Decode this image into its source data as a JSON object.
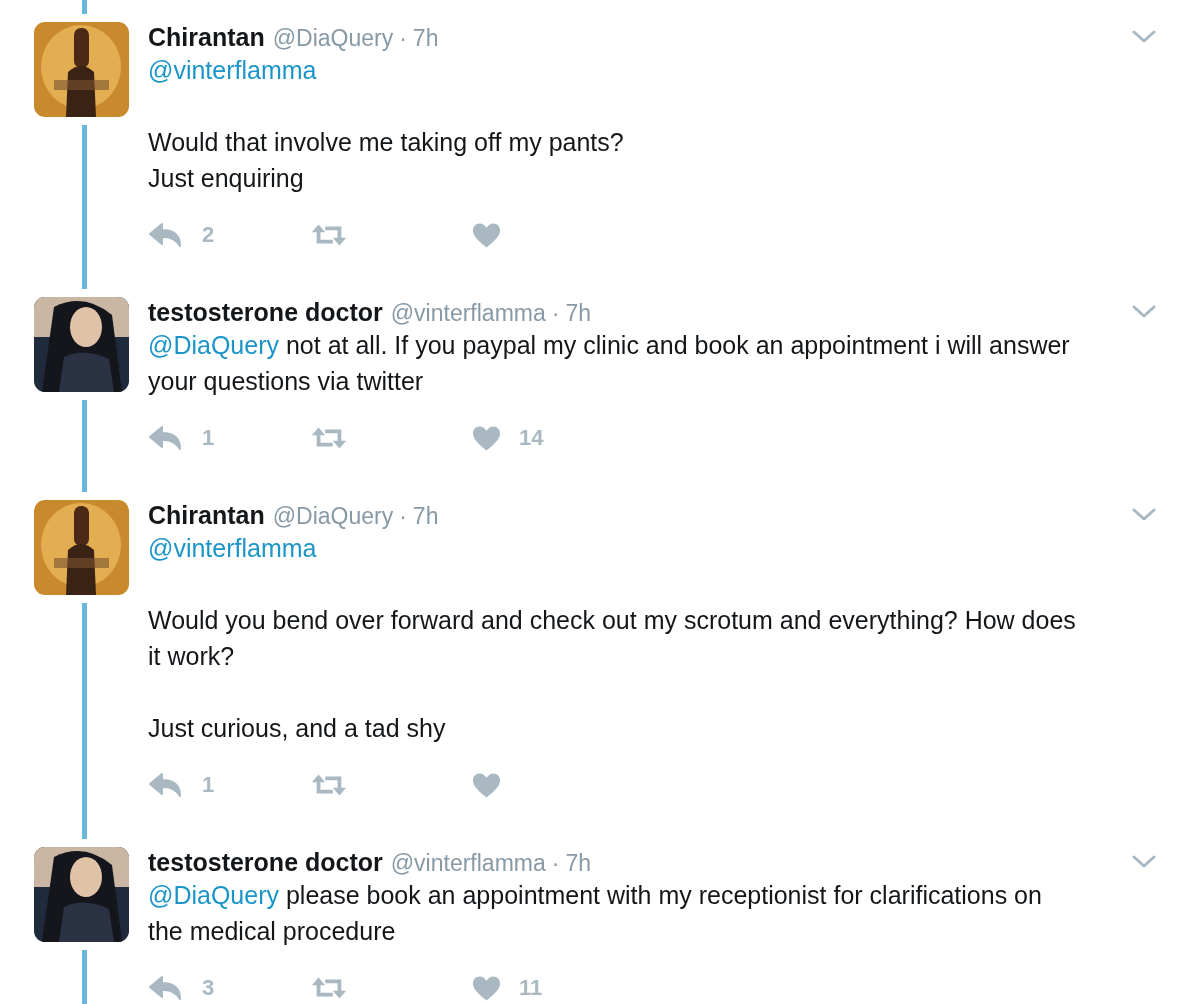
{
  "tweets": [
    {
      "avatar": {
        "kind": "picture"
      },
      "name": "Chirantan",
      "handle": "@DiaQuery",
      "separator": "·",
      "time": "7h",
      "paragraphs": [
        {
          "mention": "@vinterflamma"
        },
        {
          "text": "Would that involve me taking off my pants?\nJust enquiring"
        }
      ],
      "reply_count": "2"
    },
    {
      "avatar": {
        "kind": "picture"
      },
      "name": "testosterone doctor",
      "handle": "@vinterflamma",
      "separator": "·",
      "time": "7h",
      "paragraphs": [
        {
          "mention": "@DiaQuery",
          "text": "not at all. If you paypal my clinic and book an appointment i will answer your questions via twitter"
        }
      ],
      "reply_count": "1",
      "like_count": "14"
    },
    {
      "avatar": {
        "kind": "picture"
      },
      "name": "Chirantan",
      "handle": "@DiaQuery",
      "separator": "·",
      "time": "7h",
      "paragraphs": [
        {
          "mention": "@vinterflamma"
        },
        {
          "text": "Would you bend over forward and check out my scrotum and everything? How does it work?"
        },
        {
          "text": "Just curious, and a tad shy"
        }
      ],
      "reply_count": "1"
    },
    {
      "avatar": {
        "kind": "picture"
      },
      "name": "testosterone doctor",
      "handle": "@vinterflamma",
      "separator": "·",
      "time": "7h",
      "paragraphs": [
        {
          "mention": "@DiaQuery",
          "text": "please book an appointment with my receptionist for clarifications on the medical procedure"
        }
      ],
      "reply_count": "3",
      "like_count": "11"
    }
  ]
}
